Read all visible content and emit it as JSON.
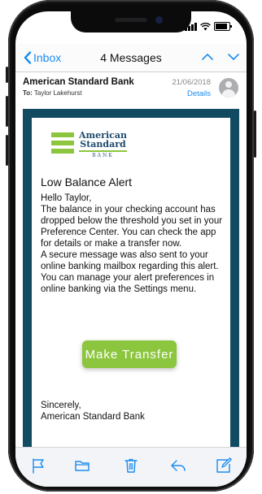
{
  "nav": {
    "back_label": "Inbox",
    "title": "4 Messages"
  },
  "message": {
    "sender": "American Standard Bank",
    "to_prefix": "To:",
    "to_name": "Taylor Lakehurst",
    "date": "21/06/2018",
    "details_label": "Details"
  },
  "email": {
    "logo": {
      "line1": "American",
      "line2": "Standard",
      "line3": "BANK"
    },
    "title": "Low Balance Alert",
    "greeting": "Hello Taylor,",
    "paragraph1": "The balance in your checking account has dropped below the threshold you set in your Preference Center. You can check the app for details or make a transfer now.",
    "paragraph2": "A secure message was also sent to your online banking mailbox regarding this alert. You can manage your alert preferences in online banking via the Settings menu.",
    "button_label": "Make Transfer",
    "signoff": "Sincerely,",
    "signature": "American Standard Bank"
  },
  "icons": {
    "back": "chevron-left-icon",
    "prev": "chevron-up-icon",
    "next": "chevron-down-icon",
    "flag": "flag-icon",
    "folder": "folder-icon",
    "trash": "trash-icon",
    "reply": "reply-icon",
    "compose": "compose-icon"
  },
  "colors": {
    "accent": "#1a8cf0",
    "brand_green": "#8cc63e",
    "brand_navy": "#114b62"
  }
}
